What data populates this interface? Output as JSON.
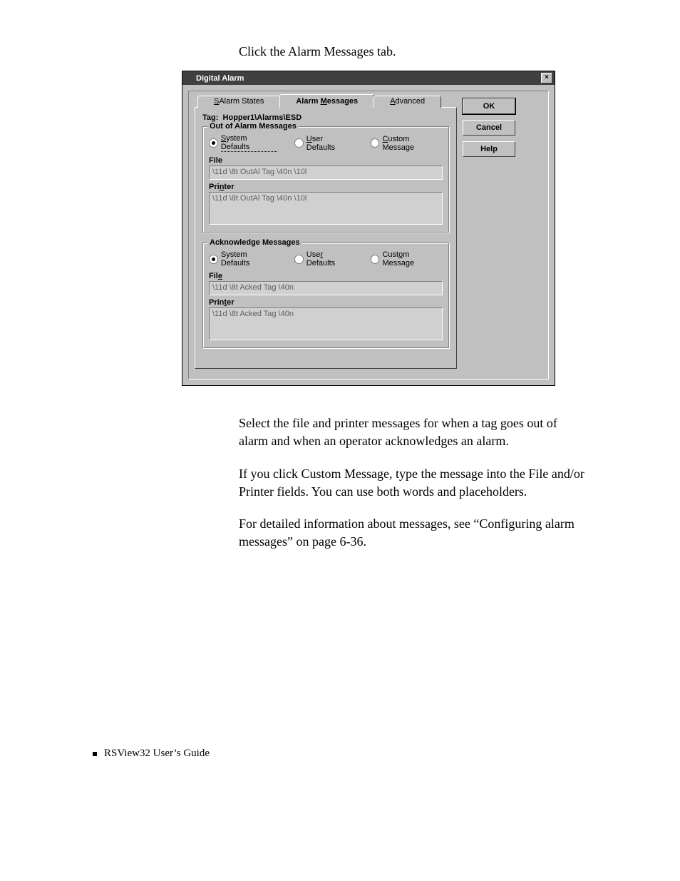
{
  "intro": "Click the Alarm Messages tab.",
  "dialog": {
    "title": "Digital Alarm",
    "close_label": "×",
    "tabs": {
      "states": "Alarm States",
      "messages": "Alarm Messages",
      "advanced": "Advanced"
    },
    "tag_label": "Tag:",
    "tag_value": "Hopper1\\Alarms\\ESD",
    "out_group": {
      "title": "Out of Alarm Messages",
      "sys": "System Defaults",
      "user": "User Defaults",
      "custom": "Custom Message",
      "file_label": "File",
      "file_value": "\\11d \\8t OutAl Tag \\40n \\10l",
      "printer_label": "Printer",
      "printer_value": "\\11d \\8t OutAl Tag \\40n \\10l"
    },
    "ack_group": {
      "title": "Acknowledge Messages",
      "sys": "System Defaults",
      "user": "User Defaults",
      "custom": "Custom Message",
      "file_label": "File",
      "file_value": "\\11d \\8t Acked Tag \\40n",
      "printer_label": "Printer",
      "printer_value": "\\11d \\8t Acked Tag \\40n"
    },
    "buttons": {
      "ok": "OK",
      "cancel": "Cancel",
      "help": "Help"
    }
  },
  "para1": "Select the file and printer messages for when a tag goes out of alarm and when an operator acknowledges an alarm.",
  "para2": "If you click Custom Message, type the message into the File and/or Printer fields. You can use both words and placeholders.",
  "para3": "For detailed information about messages, see “Configuring alarm messages” on page 6-36.",
  "footer": "RSView32  User’s Guide"
}
